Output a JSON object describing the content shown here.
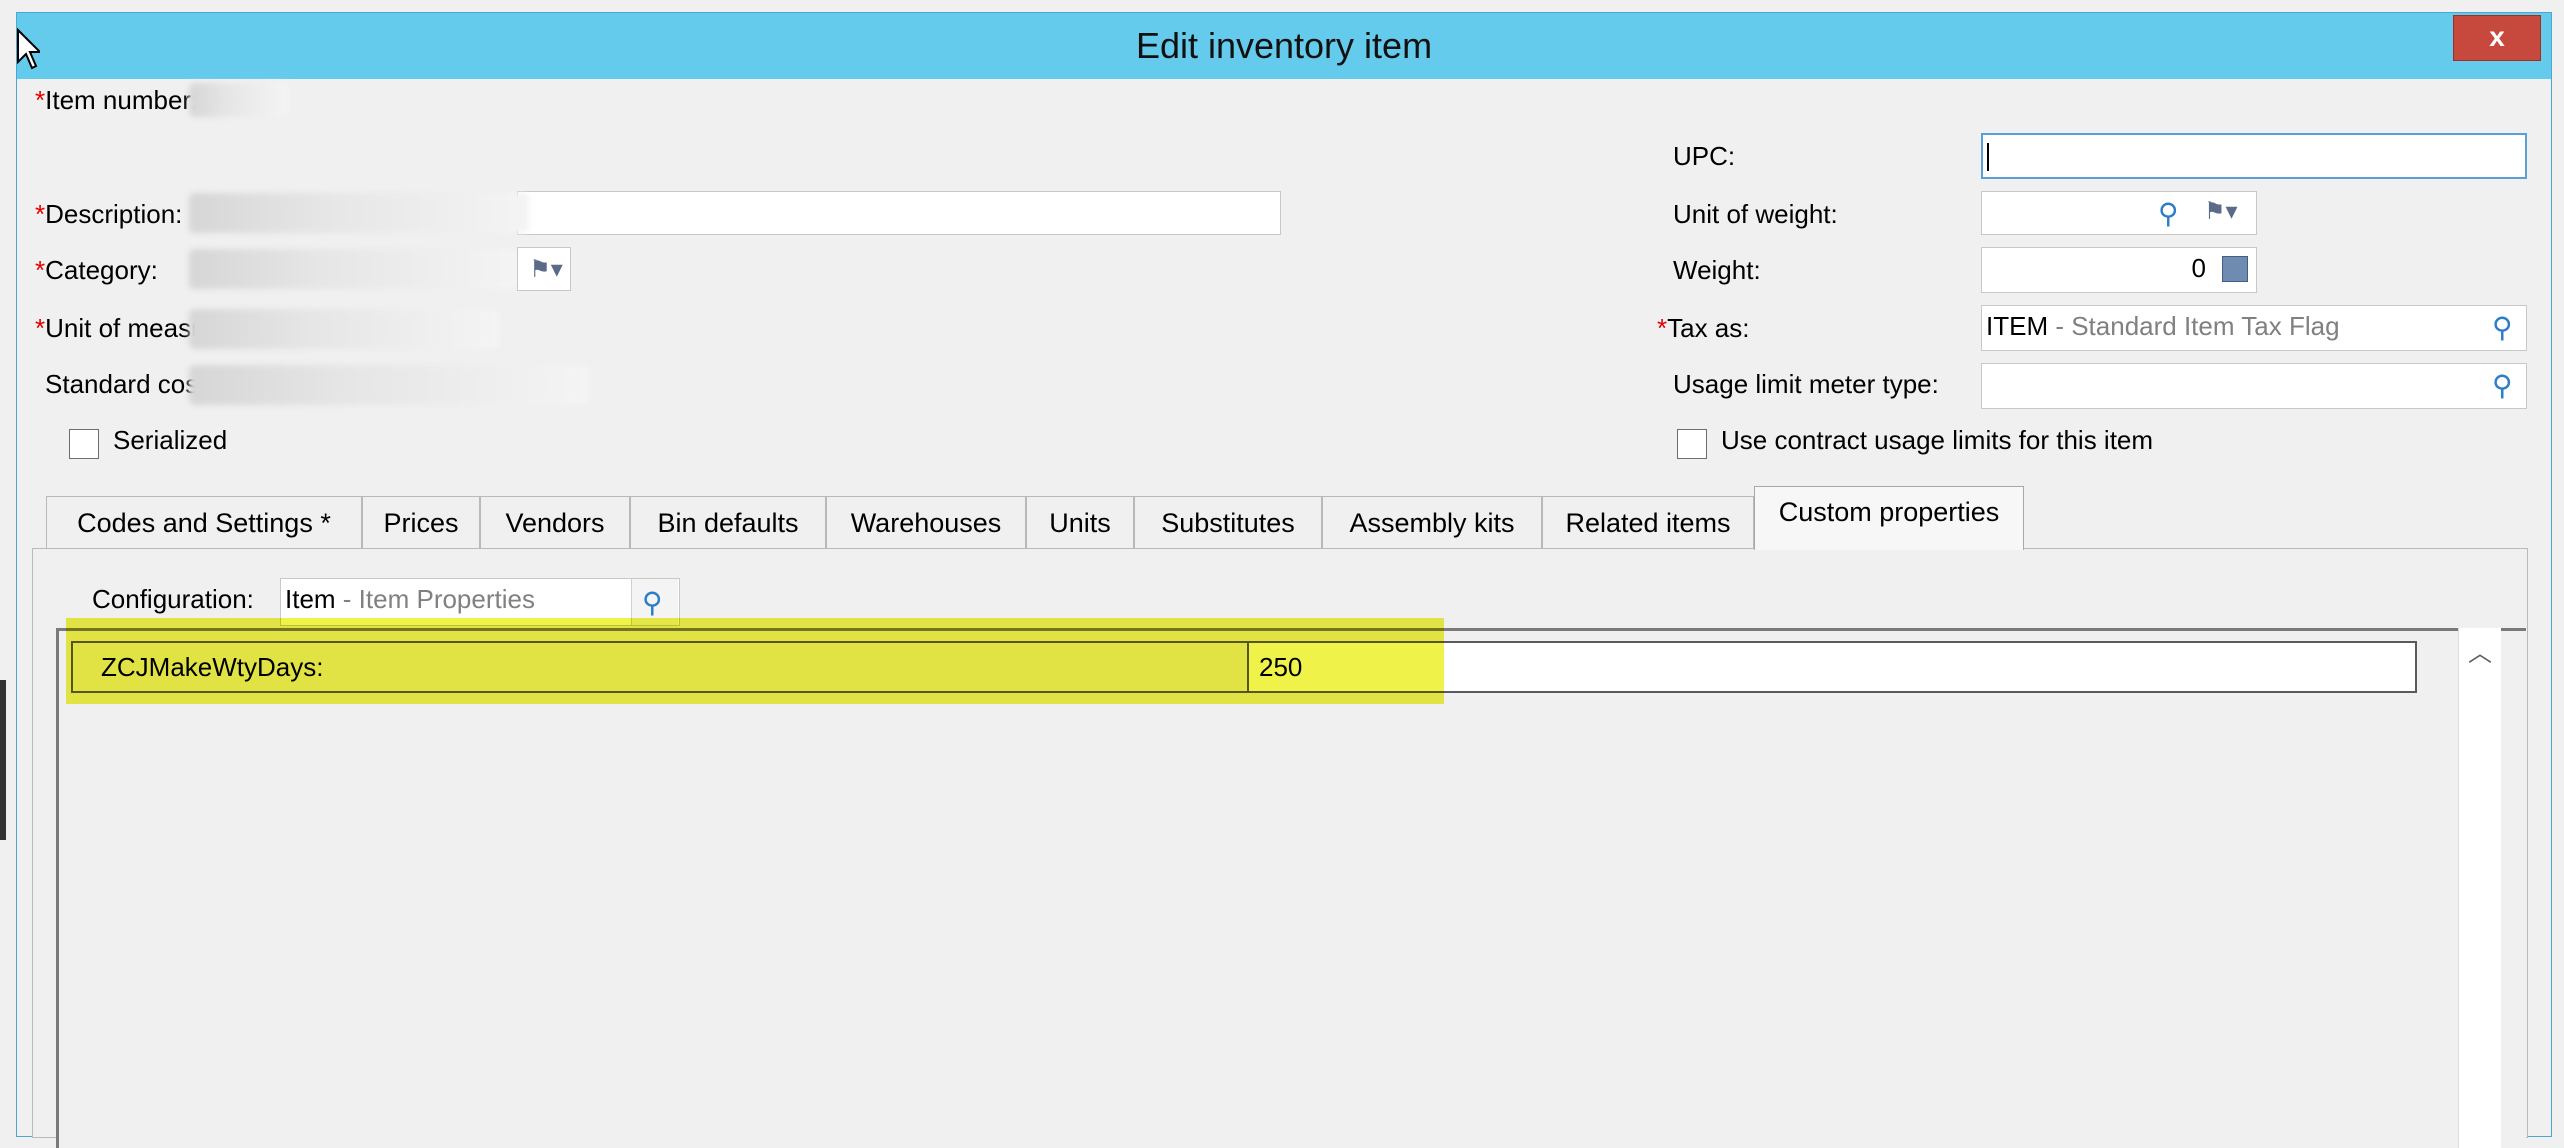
{
  "window": {
    "title": "Edit inventory item",
    "close_label": "x"
  },
  "left_fields": {
    "item_number": {
      "required": "*",
      "label": "Item number:"
    },
    "description": {
      "required": "*",
      "label": "Description:"
    },
    "category": {
      "required": "*",
      "label": "Category:"
    },
    "unit_of_measure": {
      "required": "*",
      "label": "Unit of measure:"
    },
    "standard_cost": {
      "label": "Standard cost:"
    },
    "serialized": {
      "label": "Serialized"
    }
  },
  "right_fields": {
    "upc": {
      "label": "UPC:",
      "value": ""
    },
    "unit_of_weight": {
      "label": "Unit of weight:",
      "value": ""
    },
    "weight": {
      "label": "Weight:",
      "value": "0"
    },
    "tax_as": {
      "required": "*",
      "label": "Tax as:",
      "code": "ITEM",
      "desc": " - Standard Item Tax Flag"
    },
    "usage_limit_meter_type": {
      "label": "Usage limit meter type:",
      "value": ""
    },
    "use_contract_usage_limits": {
      "label": "Use contract usage limits for this item"
    }
  },
  "tabs": [
    {
      "label": "Codes and Settings  *"
    },
    {
      "label": "Prices"
    },
    {
      "label": "Vendors"
    },
    {
      "label": "Bin defaults"
    },
    {
      "label": "Warehouses"
    },
    {
      "label": "Units"
    },
    {
      "label": "Substitutes"
    },
    {
      "label": "Assembly kits"
    },
    {
      "label": "Related items"
    },
    {
      "label": "Custom properties"
    }
  ],
  "custom_properties": {
    "configuration_label": "Configuration:",
    "configuration_code": "Item",
    "configuration_desc": " - Item Properties",
    "rows": [
      {
        "name": "ZCJMakeWtyDays:",
        "value": "250"
      }
    ]
  },
  "colors": {
    "titlebar": "#65cbec",
    "close_button": "#c7483c",
    "required_asterisk": "#e00000",
    "highlight": "#ecf028"
  },
  "icons": {
    "search": "search-icon",
    "flag": "flag-dropdown-icon",
    "calculator": "calculator-icon",
    "scroll_up": "chevron-up-icon"
  }
}
